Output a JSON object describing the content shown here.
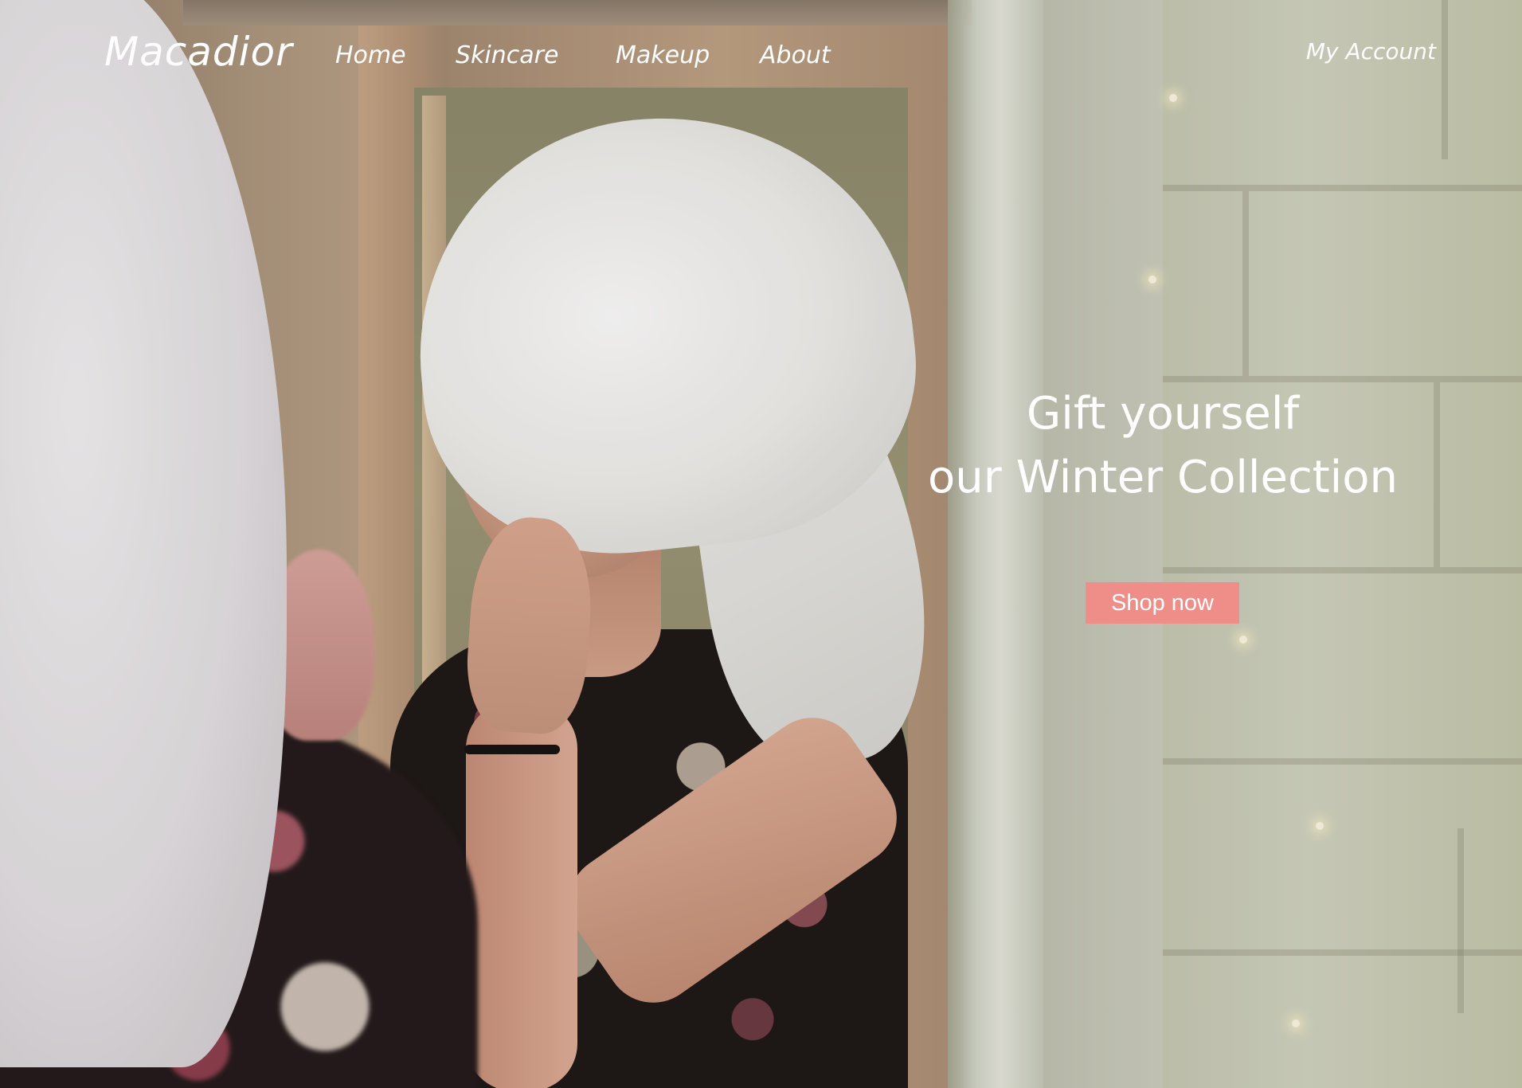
{
  "nav": {
    "brand": "Macadior",
    "links": [
      "Home",
      "Skincare",
      "Makeup",
      "About"
    ],
    "account": "My Account"
  },
  "hero": {
    "line1": "Gift yourself",
    "line2": "our Winter Collection",
    "cta": "Shop now"
  },
  "colors": {
    "cta_background": "#ef8e88",
    "text": "#ffffff"
  }
}
